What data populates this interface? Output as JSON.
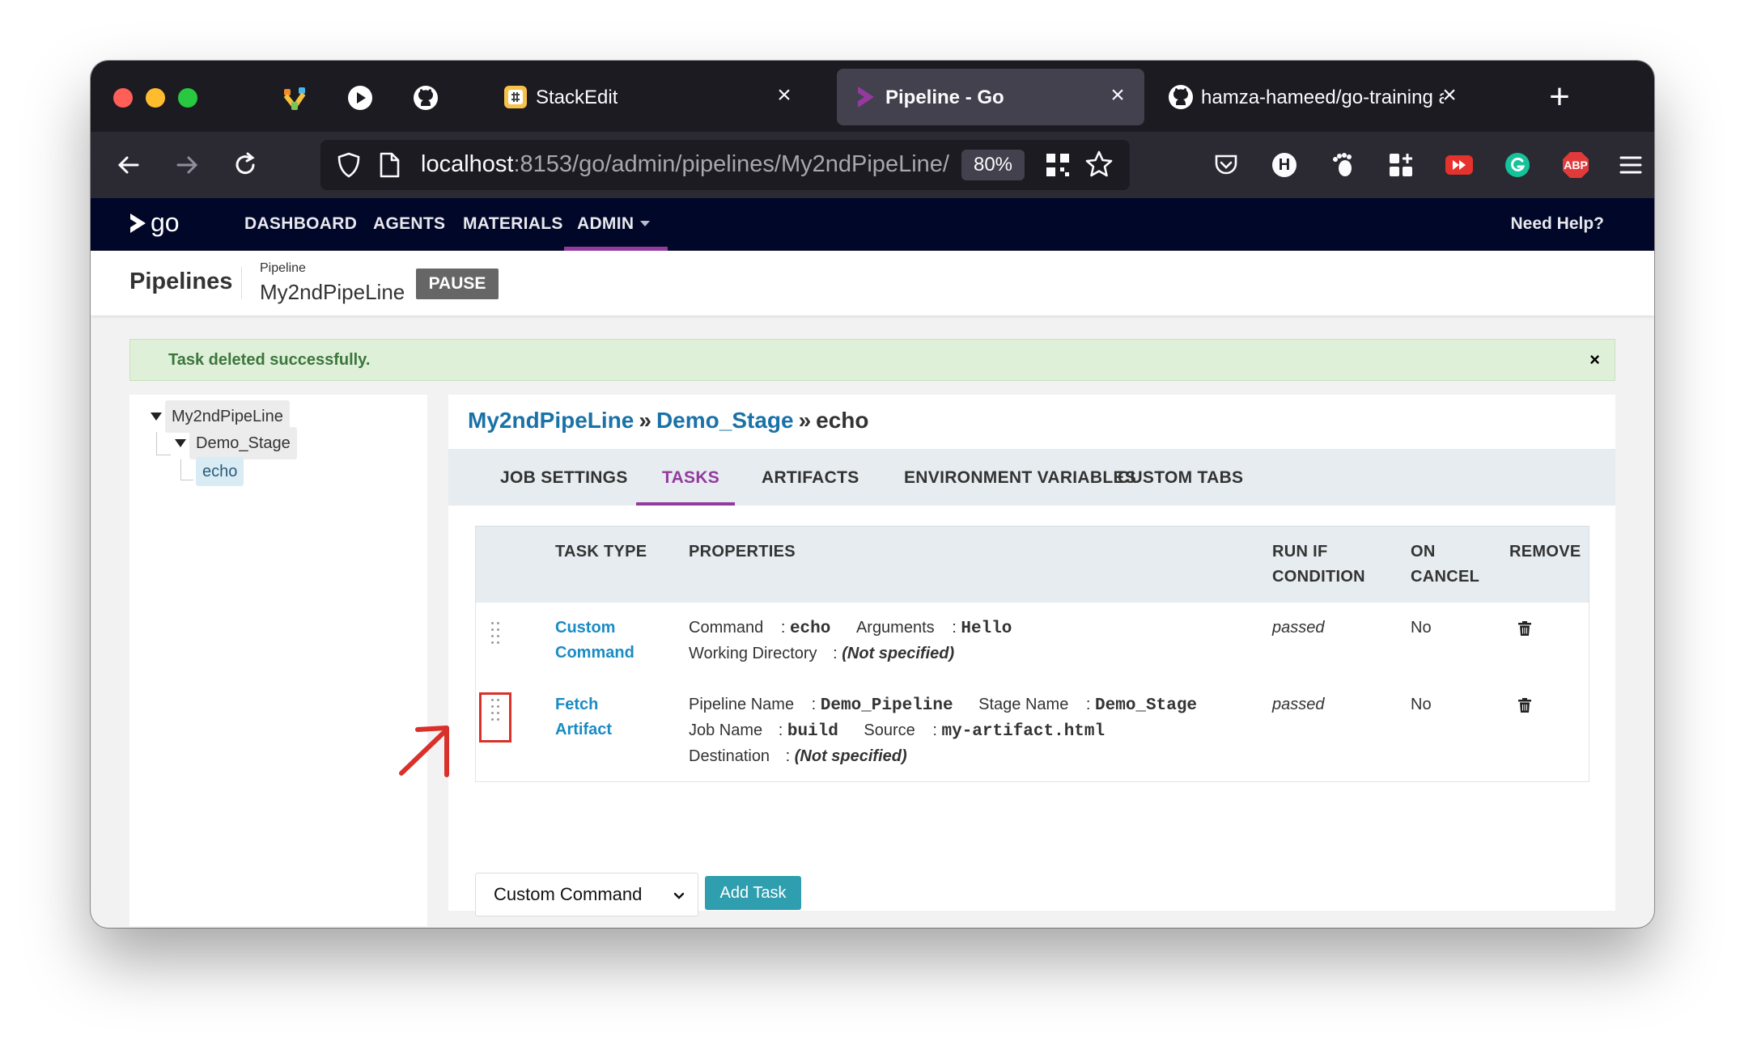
{
  "browser": {
    "tabs": [
      {
        "title": "StackEdit",
        "active": false
      },
      {
        "title": "Pipeline - Go",
        "active": true
      },
      {
        "title": "hamza-hameed/go-training at",
        "active": false
      }
    ],
    "url_host": "localhost",
    "url_path": ":8153/go/admin/pipelines/My2ndPipeLine/",
    "zoom": "80%",
    "ext_hub_letter": "H",
    "ext_abp_label": "ABP"
  },
  "app": {
    "logo_text": "go",
    "menu": {
      "dashboard": "DASHBOARD",
      "agents": "AGENTS",
      "materials": "MATERIALS",
      "admin": "ADMIN"
    },
    "need_help": "Need Help?"
  },
  "subheader": {
    "section": "Pipelines",
    "pipeline_label": "Pipeline",
    "pipeline_name": "My2ndPipeLine",
    "pause_label": "PAUSE"
  },
  "flash": {
    "message": "Task deleted successfully.",
    "close": "×"
  },
  "tree": {
    "pipeline": "My2ndPipeLine",
    "stage": "Demo_Stage",
    "job": "echo"
  },
  "breadcrumb": {
    "pipeline": "My2ndPipeLine",
    "sep1": "»",
    "stage": "Demo_Stage",
    "sep2": "»",
    "job": "echo"
  },
  "job_tabs": {
    "job_settings": "JOB SETTINGS",
    "tasks": "TASKS",
    "artifacts": "ARTIFACTS",
    "env_vars": "ENVIRONMENT VARIABLES",
    "custom_tabs": "CUSTOM TABS"
  },
  "table": {
    "headers": {
      "task_type": "TASK TYPE",
      "properties": "PROPERTIES",
      "run_if_1": "RUN IF",
      "run_if_2": "CONDITION",
      "on_cancel_1": "ON",
      "on_cancel_2": "CANCEL",
      "remove": "REMOVE"
    },
    "rows": [
      {
        "type_line1": "Custom",
        "type_line2": "Command",
        "props": {
          "command_label": "Command",
          "command_value": "echo",
          "arguments_label": "Arguments",
          "arguments_value": "Hello",
          "workdir_label": "Working Directory",
          "workdir_value": "(Not specified)"
        },
        "run_if": "passed",
        "on_cancel": "No"
      },
      {
        "type_line1": "Fetch",
        "type_line2": "Artifact",
        "props": {
          "pipeline_label": "Pipeline Name",
          "pipeline_value": "Demo_Pipeline",
          "stage_label": "Stage Name",
          "stage_value": "Demo_Stage",
          "job_label": "Job Name",
          "job_value": "build",
          "source_label": "Source",
          "source_value": "my-artifact.html",
          "dest_label": "Destination",
          "dest_value": "(Not specified)"
        },
        "run_if": "passed",
        "on_cancel": "No"
      }
    ],
    "colon": ":"
  },
  "add_task": {
    "select_value": "Custom Command",
    "button_label": "Add Task"
  },
  "colors": {
    "accent_purple": "#943a9e",
    "link_blue": "#1a72a8",
    "task_link": "#1a8bc4",
    "success_bg": "#dff0d8",
    "button_teal": "#2f9fb0",
    "annotation_red": "#d9302a"
  }
}
